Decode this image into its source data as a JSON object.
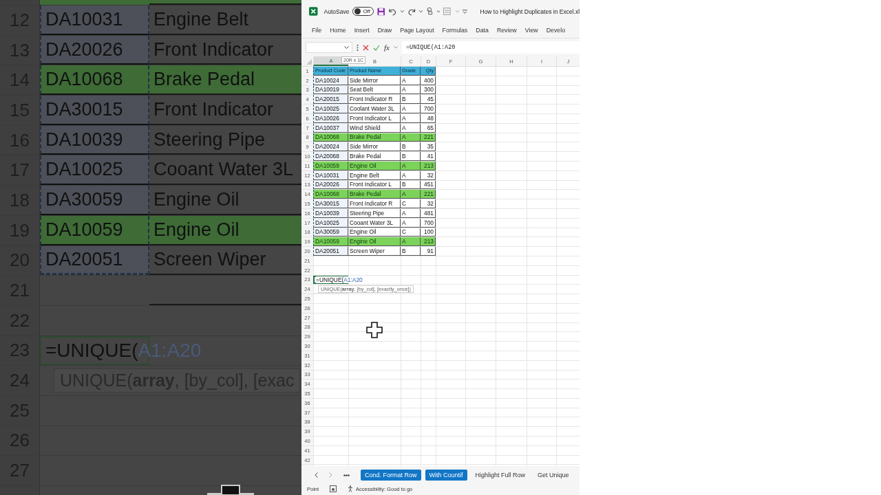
{
  "zoom_view": {
    "partial_top_row": {
      "highlight": true
    },
    "rows": [
      {
        "number": "12",
        "code": "DA10031",
        "name": "Engine Belt",
        "highlight": false
      },
      {
        "number": "13",
        "code": "DA20026",
        "name": "Front Indicator",
        "highlight": false
      },
      {
        "number": "14",
        "code": "DA10068",
        "name": "Brake Pedal",
        "highlight": true
      },
      {
        "number": "15",
        "code": "DA30015",
        "name": "Front Indicator",
        "highlight": false
      },
      {
        "number": "16",
        "code": "DA10039",
        "name": "Steering Pipe",
        "highlight": false
      },
      {
        "number": "17",
        "code": "DA10025",
        "name": "Cooant Water 3L",
        "highlight": false
      },
      {
        "number": "18",
        "code": "DA30059",
        "name": "Engine Oil",
        "highlight": false
      },
      {
        "number": "19",
        "code": "DA10059",
        "name": "Engine Oil",
        "highlight": true
      },
      {
        "number": "20",
        "code": "DA20051",
        "name": "Screen Wiper",
        "highlight": false
      },
      {
        "number": "21"
      },
      {
        "number": "22"
      },
      {
        "number": "23",
        "formula": {
          "text": "=UNIQUE(",
          "ref": "A1:A20"
        }
      },
      {
        "number": "24",
        "hint": "UNIQUE(**array**, [by_col], [exac"
      },
      {
        "number": "25"
      },
      {
        "number": "26"
      },
      {
        "number": "27"
      }
    ]
  },
  "title_bar": {
    "autosave_label": "AutoSave",
    "autosave_on": false,
    "toggle_text": "Off",
    "title": "How to Highlight Duplicates in Excel.xl"
  },
  "ribbon_tabs": [
    "File",
    "Home",
    "Insert",
    "Draw",
    "Page Layout",
    "Formulas",
    "Data",
    "Review",
    "View",
    "Develo"
  ],
  "formula_bar": {
    "function_label": "fx",
    "formula": "=UNIQUE(A1:A20"
  },
  "selection_tooltip": "20R x 1C",
  "columns": [
    "A",
    "B",
    "C",
    "D",
    "F",
    "G",
    "H",
    "I",
    "J"
  ],
  "rows": [
    {
      "number": "1",
      "kind": "header",
      "cells": [
        "Product Code",
        "Product Name",
        "Grade",
        "Qty"
      ]
    },
    {
      "number": "2",
      "kind": "data",
      "highlight": false,
      "cells": [
        "DA10024",
        "Side Mirror",
        "A",
        "400"
      ]
    },
    {
      "number": "3",
      "kind": "data",
      "highlight": false,
      "cells": [
        "DA10019",
        "Seat Belt",
        "A",
        "300"
      ]
    },
    {
      "number": "4",
      "kind": "data",
      "highlight": false,
      "cells": [
        "DA20015",
        "Front Indicator R",
        "B",
        "45"
      ]
    },
    {
      "number": "5",
      "kind": "data",
      "highlight": false,
      "cells": [
        "DA10025",
        "Coolant Water 3L",
        "A",
        "700"
      ]
    },
    {
      "number": "6",
      "kind": "data",
      "highlight": false,
      "cells": [
        "DA10026",
        "Front Indicator L",
        "A",
        "48"
      ]
    },
    {
      "number": "7",
      "kind": "data",
      "highlight": false,
      "cells": [
        "DA10037",
        "Wind Shield",
        "A",
        "65"
      ]
    },
    {
      "number": "8",
      "kind": "data",
      "highlight": true,
      "cells": [
        "DA10068",
        "Brake Pedal",
        "A",
        "221"
      ]
    },
    {
      "number": "9",
      "kind": "data",
      "highlight": false,
      "cells": [
        "DA20024",
        "Side Mirror",
        "B",
        "35"
      ]
    },
    {
      "number": "10",
      "kind": "data",
      "highlight": false,
      "cells": [
        "DA20068",
        "Brake Pedal",
        "B",
        "41"
      ]
    },
    {
      "number": "11",
      "kind": "data",
      "highlight": true,
      "cells": [
        "DA10059",
        "Engine Oil",
        "A",
        "213"
      ]
    },
    {
      "number": "12",
      "kind": "data",
      "highlight": false,
      "cells": [
        "DA10031",
        "Engine Belt",
        "A",
        "32"
      ]
    },
    {
      "number": "13",
      "kind": "data",
      "highlight": false,
      "cells": [
        "DA20026",
        "Front Indicator L",
        "B",
        "451"
      ]
    },
    {
      "number": "14",
      "kind": "data",
      "highlight": true,
      "cells": [
        "DA10068",
        "Brake Pedal",
        "A",
        "221"
      ]
    },
    {
      "number": "15",
      "kind": "data",
      "highlight": false,
      "cells": [
        "DA30015",
        "Front Indicator R",
        "C",
        "32"
      ]
    },
    {
      "number": "16",
      "kind": "data",
      "highlight": false,
      "cells": [
        "DA10039",
        "Steering Pipe",
        "A",
        "481"
      ]
    },
    {
      "number": "17",
      "kind": "data",
      "highlight": false,
      "cells": [
        "DA10025",
        "Cooant Water 3L",
        "A",
        "700"
      ]
    },
    {
      "number": "18",
      "kind": "data",
      "highlight": false,
      "cells": [
        "DA30059",
        "Engine Oil",
        "C",
        "100"
      ]
    },
    {
      "number": "19",
      "kind": "data",
      "highlight": true,
      "cells": [
        "DA10059",
        "Engine Oil",
        "A",
        "213"
      ]
    },
    {
      "number": "20",
      "kind": "data",
      "highlight": false,
      "cells": [
        "DA20051",
        "Screen Wiper",
        "B",
        "91"
      ]
    },
    {
      "number": "21",
      "kind": "empty"
    },
    {
      "number": "22",
      "kind": "empty"
    },
    {
      "number": "23",
      "kind": "formula",
      "formula": {
        "text": "=UNIQUE(",
        "ref": "A1:A20"
      }
    },
    {
      "number": "24",
      "kind": "hint",
      "hint": "UNIQUE(**array**, [by_col], [exactly_once])"
    },
    {
      "number": "25",
      "kind": "empty"
    },
    {
      "number": "26",
      "kind": "empty"
    },
    {
      "number": "27",
      "kind": "empty"
    },
    {
      "number": "28",
      "kind": "empty"
    },
    {
      "number": "29",
      "kind": "empty"
    },
    {
      "number": "30",
      "kind": "empty"
    },
    {
      "number": "31",
      "kind": "empty"
    },
    {
      "number": "32",
      "kind": "empty"
    },
    {
      "number": "33",
      "kind": "empty"
    },
    {
      "number": "34",
      "kind": "empty"
    },
    {
      "number": "35",
      "kind": "empty"
    },
    {
      "number": "36",
      "kind": "empty"
    },
    {
      "number": "37",
      "kind": "empty"
    },
    {
      "number": "38",
      "kind": "empty"
    },
    {
      "number": "39",
      "kind": "empty"
    },
    {
      "number": "40",
      "kind": "empty"
    },
    {
      "number": "41",
      "kind": "empty"
    },
    {
      "number": "42",
      "kind": "empty"
    }
  ],
  "sheet_tabs": [
    {
      "label": "Cond. Format Row",
      "color": "#1276c6"
    },
    {
      "label": "With Countif",
      "color": "#1276c6"
    },
    {
      "label": "Highlight Full Row"
    },
    {
      "label": "Get Unique"
    }
  ],
  "status_bar": {
    "mode": "Point",
    "accessibility": "Accessibility: Good to go"
  }
}
